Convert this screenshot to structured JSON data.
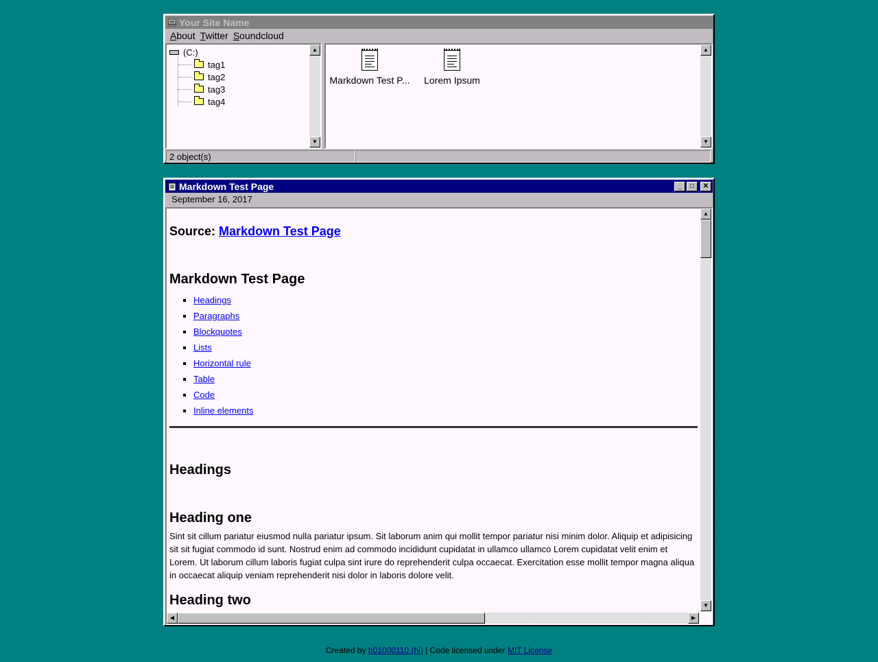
{
  "explorer": {
    "title": "Your Site Name",
    "menu": [
      {
        "accel": "A",
        "rest": "bout"
      },
      {
        "accel": "T",
        "rest": "witter"
      },
      {
        "accel": "S",
        "rest": "oundcloud"
      }
    ],
    "drive_label": "(C:)",
    "tags": [
      "tag1",
      "tag2",
      "tag3",
      "tag4"
    ],
    "files": [
      "Markdown Test P...",
      "Lorem Ipsum"
    ],
    "status": "2 object(s)"
  },
  "post": {
    "title": "Markdown Test Page",
    "date": "September 16, 2017",
    "source_label": "Source:",
    "source_link": "Markdown Test Page",
    "heading": "Markdown Test Page",
    "toc": [
      "Headings",
      "Paragraphs",
      "Blockquotes",
      "Lists",
      "Horizontal rule",
      "Table",
      "Code",
      "Inline elements"
    ],
    "section_heading": "Headings",
    "heading_one": "Heading one",
    "paragraph": "Sint sit cillum pariatur eiusmod nulla pariatur ipsum. Sit laborum anim qui mollit tempor pariatur nisi minim dolor. Aliquip et adipisicing sit sit fugiat commodo id sunt. Nostrud enim ad commodo incididunt cupidatat in ullamco ullamco Lorem cupidatat velit enim et Lorem. Ut laborum cillum laboris fugiat culpa sint irure do reprehenderit culpa occaecat. Exercitation esse mollit tempor magna aliqua in occaecat aliquip veniam reprehenderit nisi dolor in laboris dolore velit.",
    "heading_two": "Heading two"
  },
  "footer": {
    "created_by": "Created by",
    "author": "h01000110 (hi)",
    "separator": "| Code licensed under",
    "license": "MIT License"
  },
  "colors": {
    "desktop": "#008080",
    "active_title": "#000080",
    "inactive_title": "#808080",
    "window_face": "#c0bcc2"
  }
}
